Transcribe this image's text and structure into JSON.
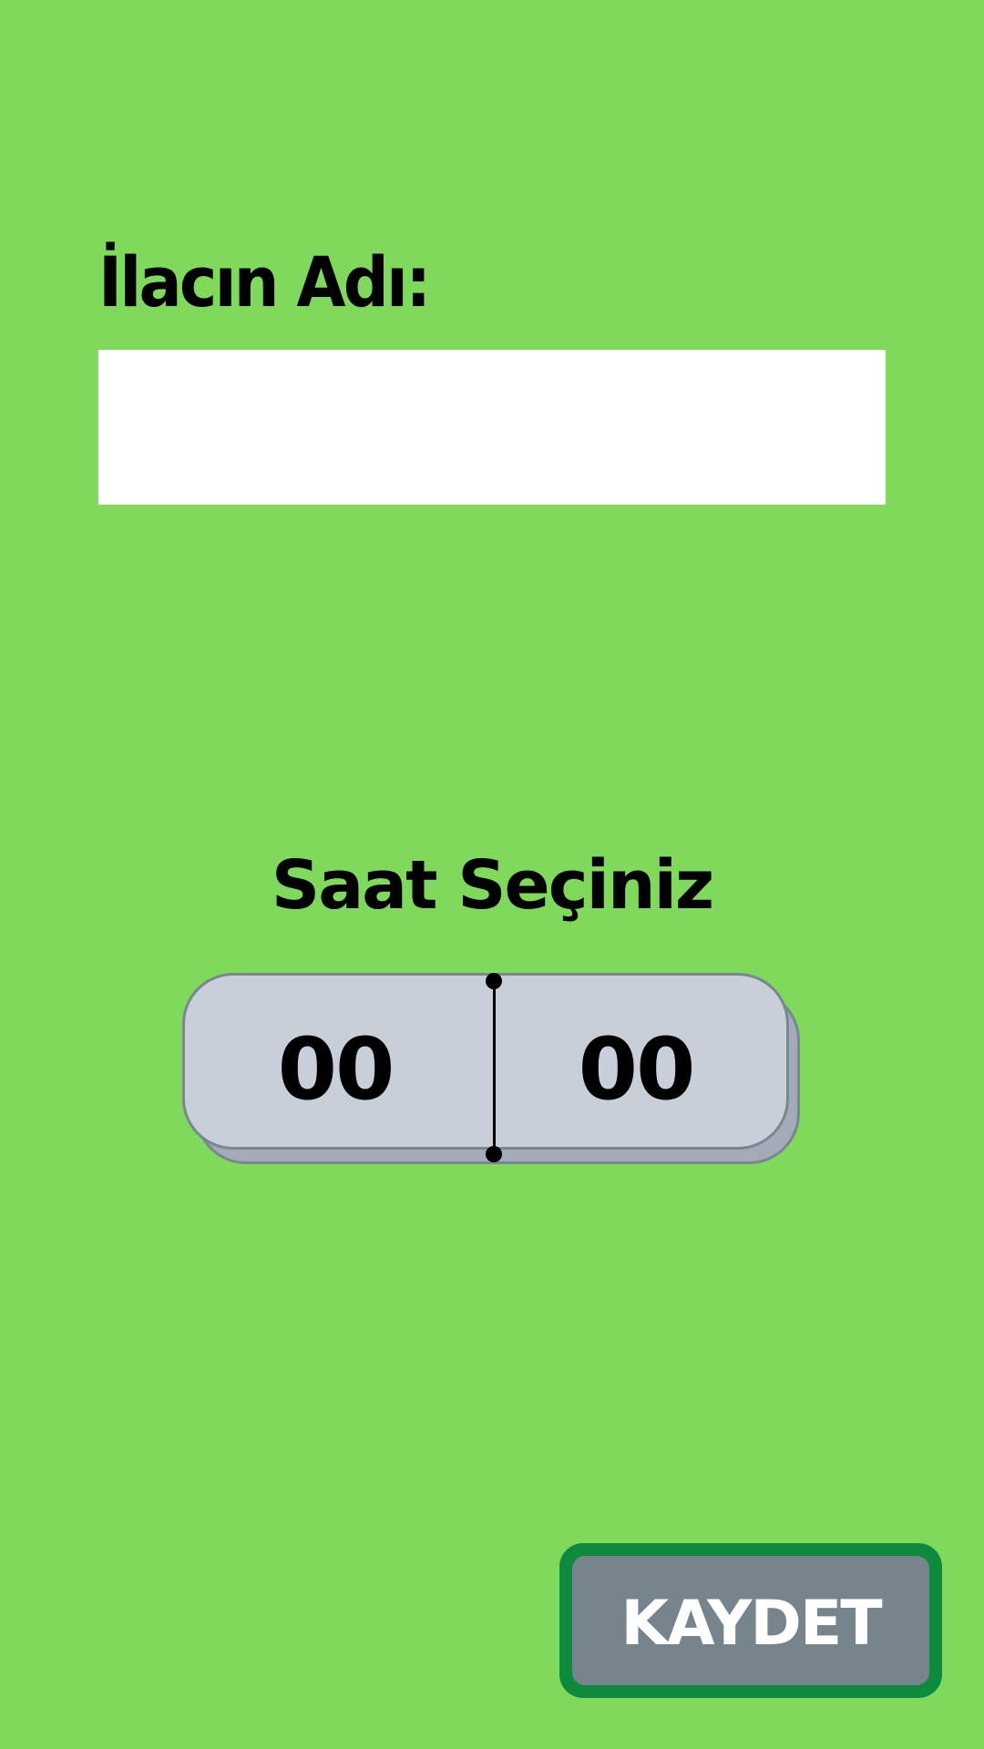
{
  "form": {
    "name_label": "İlacın Adı:",
    "name_value": "",
    "name_placeholder": ""
  },
  "time_picker": {
    "title": "Saat Seçiniz",
    "hour": "00",
    "minute": "00"
  },
  "actions": {
    "save_label": "KAYDET"
  },
  "colors": {
    "background": "#7fd95a",
    "input_background": "#ffffff",
    "picker_face": "#c8cfd8",
    "picker_shadow": "#a3abb8",
    "save_border": "#0d8a3c",
    "save_fill": "#76848c"
  }
}
